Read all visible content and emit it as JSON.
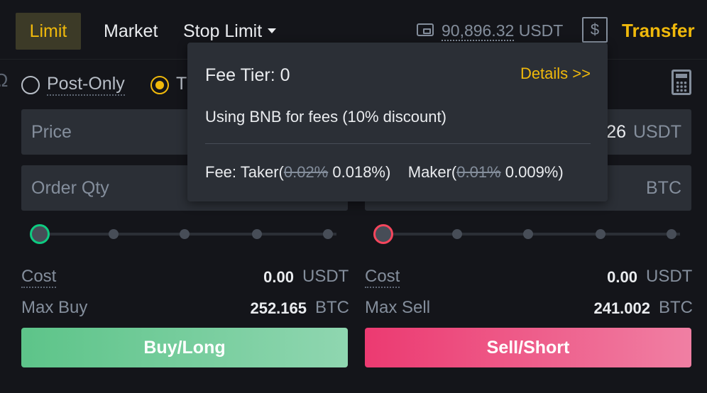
{
  "tabs": {
    "limit": "Limit",
    "market": "Market",
    "stop_limit": "Stop Limit"
  },
  "account": {
    "balance": "90,896.32",
    "balance_unit": "USDT",
    "dollar_symbol": "$",
    "transfer_label": "Transfer"
  },
  "options": {
    "post_only": "Post-Only",
    "tif_partial": "T",
    "post_only_selected": false,
    "tif_selected": true,
    "left_glyph": "Ω"
  },
  "buy_form": {
    "price_placeholder": "Price",
    "qty_placeholder": "Order Qty",
    "slider_percent": 0,
    "cost_label": "Cost",
    "cost_value": "0.00",
    "cost_unit": "USDT",
    "max_label": "Max Buy",
    "max_value": "252.165",
    "max_unit": "BTC",
    "button_label": "Buy/Long"
  },
  "sell_form": {
    "price_partial_value": "26",
    "price_unit": "USDT",
    "qty_unit": "BTC",
    "slider_percent": 0,
    "cost_label": "Cost",
    "cost_value": "0.00",
    "cost_unit": "USDT",
    "max_label": "Max Sell",
    "max_value": "241.002",
    "max_unit": "BTC",
    "button_label": "Sell/Short"
  },
  "fee_popover": {
    "title": "Fee Tier: 0",
    "details_link": "Details >>",
    "bnb_note": "Using BNB for fees (10% discount)",
    "fee_prefix": "Fee: Taker(",
    "taker_old": "0.02%",
    "taker_new": "0.018%)",
    "maker_prefix": "Maker(",
    "maker_old": "0.01%",
    "maker_new": "0.009%)"
  },
  "colors": {
    "accent": "#f0b90b",
    "buy": "#0ecb81",
    "sell": "#f6465d",
    "background": "#14151a",
    "panel": "#2b2f36"
  },
  "icons": [
    "wallet-icon",
    "dollar-icon",
    "calculator-icon",
    "caret-down-icon"
  ]
}
